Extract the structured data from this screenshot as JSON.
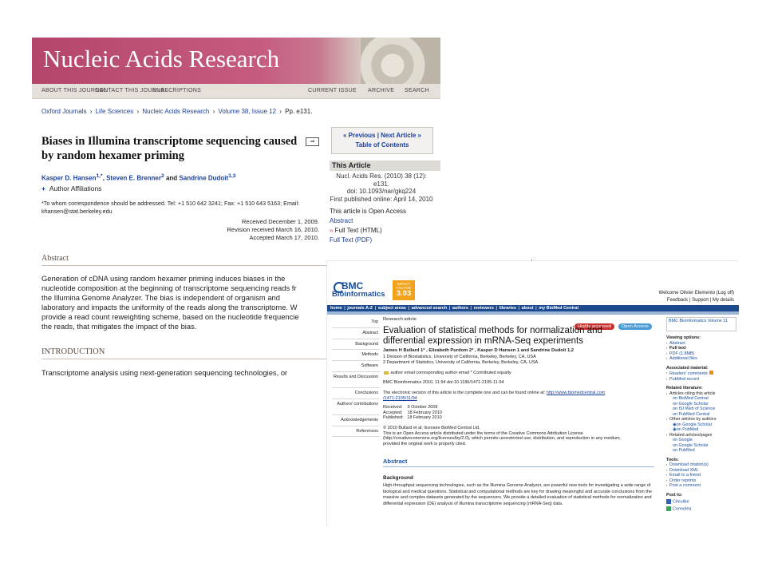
{
  "nar": {
    "title": "Nucleic Acids Research",
    "nav": [
      "ABOUT THIS JOURNAL",
      "CONTACT THIS JOURNAL",
      "SUBSCRIPTIONS",
      "CURRENT ISSUE",
      "ARCHIVE",
      "SEARCH"
    ],
    "breadcrumb": [
      "Oxford Journals",
      "Life Sciences",
      "Nucleic Acids Research",
      "Volume 38, Issue 12",
      "Pp. e131."
    ],
    "breadcrumb_sep": "›",
    "article_title": "Biases in Illumina transcriptome sequencing caused by random hexamer priming",
    "authors": {
      "a1": "Kasper D. Hansen",
      "a1_sup": "1,*",
      "a2": "Steven E. Brenner",
      "a2_sup": "2",
      "and": "and",
      "a3": "Sandrine Dudoit",
      "a3_sup": "1,3"
    },
    "author_affiliations": "Author Affiliations",
    "correspondence": "*To whom correspondence should be addressed. Tel: +1 510 642 3241; Fax: +1 510 643 5163; Email: khansen@stat.berkeley.edu",
    "received": "Received December 1, 2009.",
    "revised": "Revision received March 16, 2010.",
    "accepted": "Accepted March 17, 2010.",
    "abstract_heading": "Abstract",
    "abstract_text": "Generation of cDNA using random hexamer priming induces biases in the\nnucleotide composition at the beginning of transcriptome sequencing reads fr\nthe Illumina Genome Analyzer. The bias is independent of organism and\nlaboratory and impacts the uniformity of the reads along the transcriptome. W\nprovide a read count reweighting scheme, based on the nucleotide frequencie\nthe reads, that mitigates the impact of the bias.",
    "intro_heading": "INTRODUCTION",
    "intro_text": "Transcriptome analysis using next-generation sequencing technologies, or",
    "prev_next": "« Previous | Next Article »",
    "toc": "Table of Contents",
    "this_article": "This Article",
    "citation": "Nucl. Acids Res. (2010) 38 (12): e131.",
    "doi": "doi: 10.1093/nar/gkq224",
    "first_published": "First published online: April 14, 2010",
    "open_access": "This article is Open Access",
    "link_abstract": "Abstract",
    "link_fulltext_html": "Full Text (HTML)",
    "link_fulltext_pdf": "Full Text (PDF)"
  },
  "bmc": {
    "logo_line1": "BMC",
    "logo_line2": "Bioinformatics",
    "impact_label": "IMPACT FACTOR",
    "impact_value": "3.03",
    "welcome": "Welcome Olivier Elemento (Log off)",
    "welcome_links": "Feedback | Support | My details",
    "nav": [
      "home",
      "journals A-Z",
      "subject areas",
      "advanced search",
      "authors",
      "reviewers",
      "libraries",
      "about",
      "my BioMed Central"
    ],
    "sidebar": [
      "Top",
      "Abstract",
      "Background",
      "Methods",
      "Software",
      "Results and Discussion",
      "Conclusions",
      "Authors' contributions",
      "Acknowledgements",
      "References"
    ],
    "article_type": "Research article",
    "badge_highly": "Highly accessed",
    "badge_open": "Open Access",
    "title": "Evaluation of statistical methods for normalization and differential expression in mRNA-Seq experiments",
    "authors": "James H Bullard 1*  , Elizabeth Purdom 2*  , Kasper D Hansen 1  and Sandrine Dudoit 1,2",
    "affil1": "1   Division of Biostatistics, University of California, Berkeley, Berkeley, CA, USA",
    "affil2": "2   Department of Statistics, University of California, Berkeley, Berkeley, CA, USA",
    "legend": "author email      corresponding author email   * Contributed equally",
    "journal_ref": "BMC Bioinformatics 2010, 11:94    doi:10.1186/1471-2105-11-94",
    "ev_text": "The electronic version of this article is the complete one and can be found online at:",
    "ev_url1": "http://www.biomedcentral.com",
    "ev_url2": "/1471-2105/11/94",
    "dates": "Received:    9 October 2009\nAccepted:    18 February 2010\nPublished:   18 February 2010",
    "copyright": "© 2010 Bullard et al; licensee BioMed Central Ltd.",
    "license": "This is an Open Access article distributed under the terms of the Creative Commons Attribution License (http://creativecommons.org/licenses/by/2.0), which permits unrestricted use, distribution, and reproduction in any medium, provided the original work is properly cited.",
    "abstract_heading": "Abstract",
    "background_heading": "Background",
    "background_text": "High-throughput sequencing technologies, such as the Illumina Genome Analyzer, are powerful new tools for investigating a wide range of biological and medical questions. Statistical and computational methods are key for drawing meaningful and accurate conclusions from the massive and complex datasets generated by the sequencers. We provide a detailed evaluation of statistical methods for normalization and differential expression (DE) analysis of Illumina transcriptome sequencing (mRNA-Seq) data.",
    "journal_box": "BMC Bioinformatics Volume 11",
    "viewing_heading": "Viewing options:",
    "viewing": [
      "Abstract",
      "Full text",
      "PDF (1.8MB)",
      "Additional files"
    ],
    "assoc_heading": "Associated material:",
    "assoc": [
      "Readers' comments",
      "PubMed record"
    ],
    "related_heading": "Related literature:",
    "related": [
      "Articles citing this article",
      "on BioMed Central",
      "on Google Scholar",
      "on ISI Web of Science",
      "on PubMed Central",
      "Other articles by authors",
      "on Google Scholar",
      "on PubMed",
      "Related articles/pages",
      "on Google",
      "on Google Scholar",
      "on PubMed"
    ],
    "tools_heading": "Tools:",
    "tools": [
      "Download citation(s)",
      "Download XML",
      "Email to a friend",
      "Order reprints",
      "Post a comment"
    ],
    "post_heading": "Post to:",
    "post": [
      "Citeulike",
      "Connotea"
    ]
  },
  "colors": {
    "nar_banner": "#b4456b",
    "bmc_nav": "#1c4a8d",
    "bmc_impact": "#f2a21b",
    "badge_highly": "#c8302d",
    "badge_open": "#4a9ad6"
  }
}
